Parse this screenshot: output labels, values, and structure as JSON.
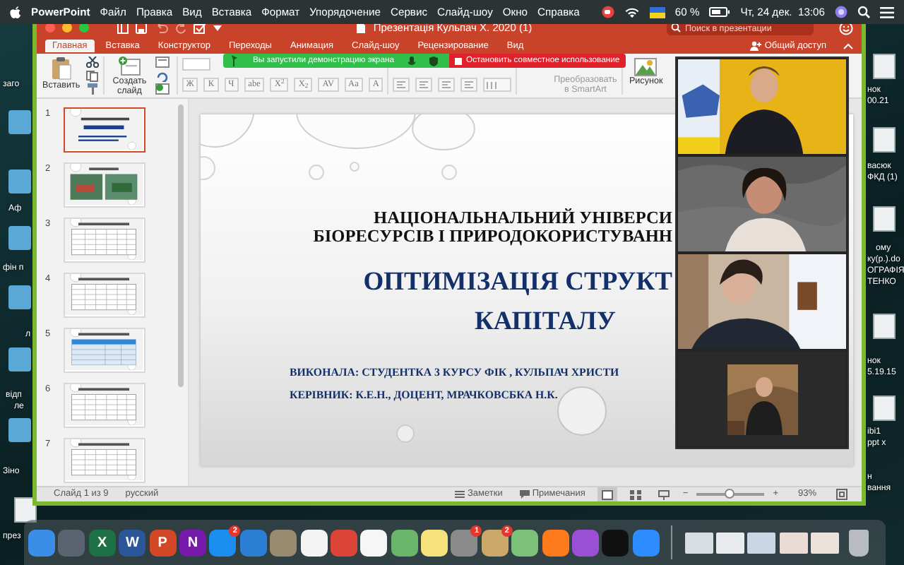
{
  "menu_bar": {
    "app": "PowerPoint",
    "items": [
      "Файл",
      "Правка",
      "Вид",
      "Вставка",
      "Формат",
      "Упорядочение",
      "Сервис",
      "Слайд-шоу",
      "Окно",
      "Справка"
    ],
    "battery": "60 %",
    "clock": "Чт, 24 дек.  13:06"
  },
  "desktop": {
    "left_labels": [
      "заго",
      "Аф",
      "фін п",
      "л",
      "відп",
      "ле",
      "Зіно",
      "през"
    ],
    "right_labels": [
      "нок",
      "00.21",
      "васюк",
      "ФКД (1)",
      "ому",
      "ку(р.).do",
      "ОГРАФІЯ",
      "ТЕНКО",
      "нок",
      "5.19.15",
      "ibi1",
      "ppt x",
      "н",
      "вання"
    ]
  },
  "window": {
    "title": "Презентація Кульпач Х. 2020 (1)",
    "search": {
      "placeholder": "Поиск в презентации"
    },
    "tabs": [
      {
        "label": "Главная",
        "selected": true
      },
      {
        "label": "Вставка",
        "selected": false
      },
      {
        "label": "Конструктор",
        "selected": false
      },
      {
        "label": "Переходы",
        "selected": false
      },
      {
        "label": "Анимация",
        "selected": false
      },
      {
        "label": "Слайд-шоу",
        "selected": false
      },
      {
        "label": "Рецензирование",
        "selected": false
      },
      {
        "label": "Вид",
        "selected": false
      }
    ],
    "share": "Общий доступ",
    "ribbon": {
      "paste": "Вставить",
      "new_slide": "Создать слайд",
      "format_buttons": [
        "Ж",
        "К",
        "Ч",
        "abe",
        "X$^{2}$",
        "X$_{2}$",
        "AV",
        "Aa",
        "A"
      ],
      "smartart": "Преобразовать в SmartArt",
      "picture": "Рисунок"
    },
    "thumbnails": [
      {
        "number": "1",
        "kind": "title",
        "selected": true
      },
      {
        "number": "2",
        "kind": "photos",
        "selected": false
      },
      {
        "number": "3",
        "kind": "table",
        "selected": false
      },
      {
        "number": "4",
        "kind": "table",
        "selected": false
      },
      {
        "number": "5",
        "kind": "blue-table",
        "selected": false
      },
      {
        "number": "6",
        "kind": "table",
        "selected": false
      },
      {
        "number": "7",
        "kind": "table",
        "selected": false
      }
    ],
    "slide": {
      "lines": [
        {
          "kind": "heading",
          "text": "НАЦІОНАЛЬНАЛЬНИЙ УНІВЕРСИ"
        },
        {
          "kind": "heading",
          "text": "БІОРЕСУРСІВ І ПРИРОДОКОРИСТУВАНН"
        },
        {
          "kind": "title",
          "text": "ОПТИМІЗАЦІЯ СТРУКТ"
        },
        {
          "kind": "title-end",
          "text": "КАПІТАЛУ"
        },
        {
          "kind": "credit",
          "text": "ВИКОНАЛА: СТУДЕНТКА 3 КУРСУ ФІК , КУЛЬПАЧ ХРИСТИ"
        },
        {
          "kind": "credit",
          "text": "КЕРІВНИК:  К.Е.Н., ДОЦЕНТ,  МРАЧКОВСБКА Н.К."
        }
      ]
    },
    "status_bar": {
      "slide": "Слайд 1 из 9",
      "language": "русский",
      "notes": "Заметки",
      "comments": "Примечания",
      "minus": "−",
      "plus": "+",
      "zoom": "93%",
      "level": 0.47
    }
  },
  "share_banner": {
    "message": "Вы запустили демонстрацию экрана",
    "stop": "Остановить совместное использование"
  },
  "dock": [
    {
      "kind": "app",
      "color": "#3a8ee8"
    },
    {
      "kind": "app",
      "color": "#5a6470"
    },
    {
      "kind": "app",
      "color": "#1e7145",
      "glyph": "X"
    },
    {
      "kind": "app",
      "color": "#2b579a",
      "glyph": "W"
    },
    {
      "kind": "app",
      "color": "#d24726",
      "glyph": "P"
    },
    {
      "kind": "app",
      "color": "#7719aa",
      "glyph": "N"
    },
    {
      "kind": "app",
      "color": "#1c8ef0",
      "badge": "2"
    },
    {
      "kind": "app",
      "color": "#2a7fd4"
    },
    {
      "kind": "app",
      "color": "#9a8a70"
    },
    {
      "kind": "app",
      "color": "#f4f4f4"
    },
    {
      "kind": "app",
      "color": "#db4437"
    },
    {
      "kind": "app",
      "color": "#f6f6f6"
    },
    {
      "kind": "app",
      "color": "#6bb56b"
    },
    {
      "kind": "app",
      "color": "#f5e27a"
    },
    {
      "kind": "app",
      "color": "#8a8a8a",
      "badge": "1"
    },
    {
      "kind": "app",
      "color": "#c9a86a",
      "badge": "2"
    },
    {
      "kind": "app",
      "color": "#7cc17a"
    },
    {
      "kind": "app",
      "color": "#ff7a1a"
    },
    {
      "kind": "app",
      "color": "#9b4fd6"
    },
    {
      "kind": "app",
      "color": "#111111"
    },
    {
      "kind": "app",
      "color": "#2d8cff"
    },
    {
      "kind": "divider"
    },
    {
      "kind": "window",
      "color": "#d8dde3"
    },
    {
      "kind": "window",
      "color": "#e8ecef"
    },
    {
      "kind": "window",
      "color": "#c9d6e6"
    },
    {
      "kind": "window",
      "color": "#eadbd6"
    },
    {
      "kind": "window",
      "color": "#ece2dc"
    },
    {
      "kind": "trash",
      "color": "#b8bcc0"
    }
  ]
}
